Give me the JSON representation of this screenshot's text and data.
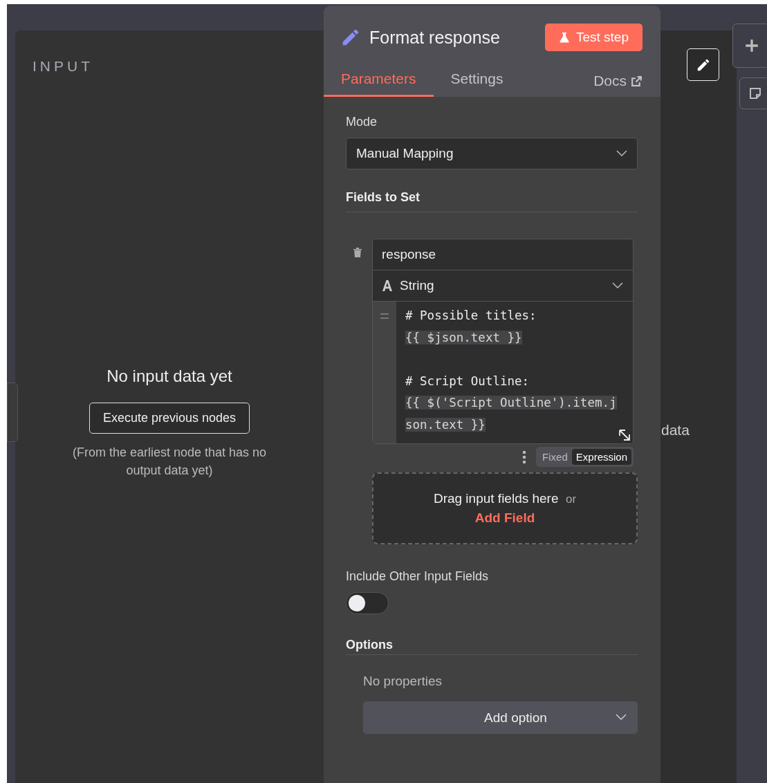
{
  "input_panel": {
    "title": "INPUT",
    "empty_title": "No input data yet",
    "button": "Execute previous nodes",
    "hint": "(From the earliest node that has no output data yet)"
  },
  "node": {
    "title": "Format response",
    "test_button": "Test step",
    "tabs": [
      {
        "label": "Parameters",
        "selected": true
      },
      {
        "label": "Settings",
        "selected": false
      }
    ],
    "docs_link": "Docs"
  },
  "parameters": {
    "mode": {
      "label": "Mode",
      "value": "Manual Mapping"
    },
    "fields_to_set": {
      "label": "Fields to Set",
      "fields": [
        {
          "name": "response",
          "type": "String",
          "value_blocks": [
            [
              {
                "text": "# Possible titles:",
                "kind": "comment"
              },
              {
                "text": "{{ $json.text }}",
                "kind": "expression"
              }
            ],
            [
              {
                "text": "# Script Outline:",
                "kind": "comment"
              },
              {
                "text": "{{ $('Script Outline').item.j",
                "kind": "expression"
              },
              {
                "text": "son.text }}",
                "kind": "expression"
              }
            ]
          ],
          "modes": [
            {
              "label": "Fixed",
              "selected": false
            },
            {
              "label": "Expression",
              "selected": true
            }
          ]
        }
      ],
      "drop_zone": {
        "text": "Drag input fields here",
        "or": "or",
        "link": "Add Field"
      }
    },
    "include_other": {
      "label": "Include Other Input Fields",
      "on": false
    },
    "options": {
      "label": "Options",
      "empty": "No properties",
      "button": "Add option"
    }
  },
  "output_panel": {
    "text": "data"
  }
}
